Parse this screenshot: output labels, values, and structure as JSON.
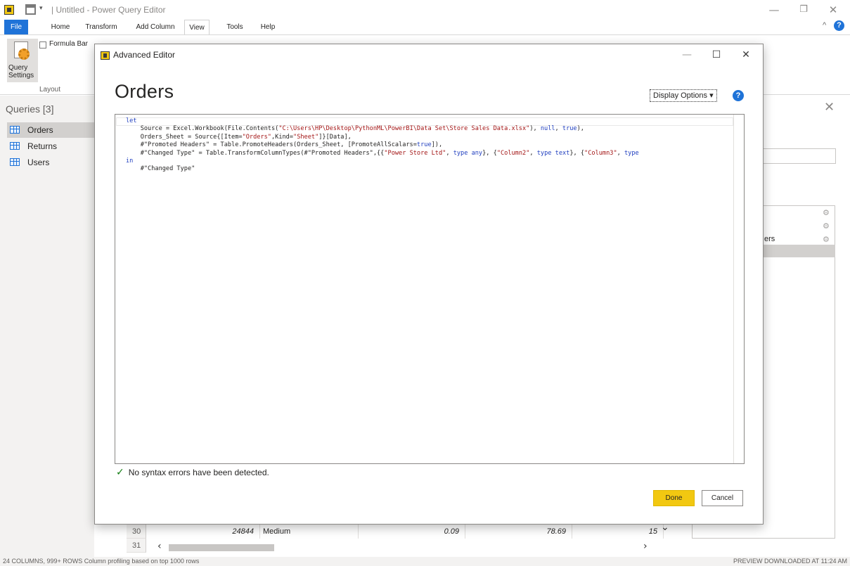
{
  "window": {
    "title": "| Untitled - Power Query Editor",
    "minimize_glyph": "—",
    "restore_glyph": "❐",
    "close_glyph": "✕"
  },
  "ribbon": {
    "tabs": [
      "File",
      "Home",
      "Transform",
      "Add Column",
      "View",
      "Tools",
      "Help"
    ],
    "active_tab": "View",
    "query_settings_label": "Query Settings",
    "formula_bar_label": "Formula Bar",
    "layout_group_label": "Layout",
    "help_glyph": "?"
  },
  "queries": {
    "title": "Queries [3]",
    "items": [
      {
        "label": "Orders",
        "selected": true
      },
      {
        "label": "Returns",
        "selected": false
      },
      {
        "label": "Users",
        "selected": false
      }
    ]
  },
  "right_pane": {
    "close_glyph": "✕",
    "step_text_fragment": "ers",
    "gear_glyph": "⚙"
  },
  "grid": {
    "rows": [
      {
        "num": "30",
        "c1": "24844",
        "c2": "Medium",
        "c3": "0.09",
        "c4": "78.69",
        "c5": "15"
      },
      {
        "num": "31",
        "c1": "",
        "c2": "",
        "c3": "",
        "c4": "",
        "c5": ""
      }
    ]
  },
  "status": {
    "left": "24 COLUMNS, 999+ ROWS    Column profiling based on top 1000 rows",
    "right": "PREVIEW DOWNLOADED AT 11:24 AM"
  },
  "dialog": {
    "title": "Advanced Editor",
    "heading": "Orders",
    "display_options": "Display Options",
    "help_glyph": "?",
    "syntax_message": "No syntax errors have been detected.",
    "done_label": "Done",
    "cancel_label": "Cancel",
    "code_lines": [
      "let",
      "    Source = Excel.Workbook(File.Contents(\"C:\\Users\\HP\\Desktop\\PythonML\\PowerBI\\Data Set\\Store Sales Data.xlsx\"), null, true),",
      "    Orders_Sheet = Source{[Item=\"Orders\",Kind=\"Sheet\"]}[Data],",
      "    #\"Promoted Headers\" = Table.PromoteHeaders(Orders_Sheet, [PromoteAllScalars=true]),",
      "    #\"Changed Type\" = Table.TransformColumnTypes(#\"Promoted Headers\",{{\"Power Store Ltd\", type any}, {\"Column2\", type text}, {\"Column3\", type",
      "in",
      "    #\"Changed Type\""
    ]
  }
}
